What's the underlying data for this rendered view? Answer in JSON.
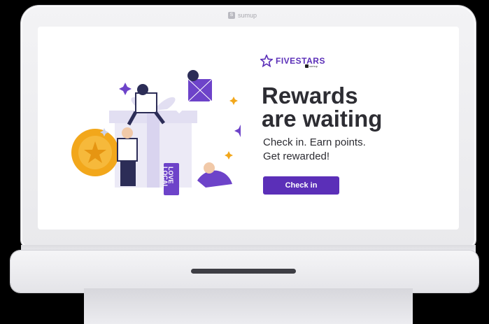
{
  "device": {
    "logo_text": "sumup",
    "logo_glyph": "S"
  },
  "screen": {
    "brand": {
      "name": "FIVESTARS",
      "sub": "sumup"
    },
    "headline_line1": "Rewards",
    "headline_line2": "are waiting",
    "subtext_line1": "Check in. Earn points.",
    "subtext_line2": "Get rewarded!",
    "cta_label": "Check in",
    "tag_text_1": "LOVE",
    "tag_text_2": "LOCAL"
  },
  "colors": {
    "accent": "#5b2fb8",
    "coin": "#f2a71b",
    "text": "#2d2d33"
  }
}
